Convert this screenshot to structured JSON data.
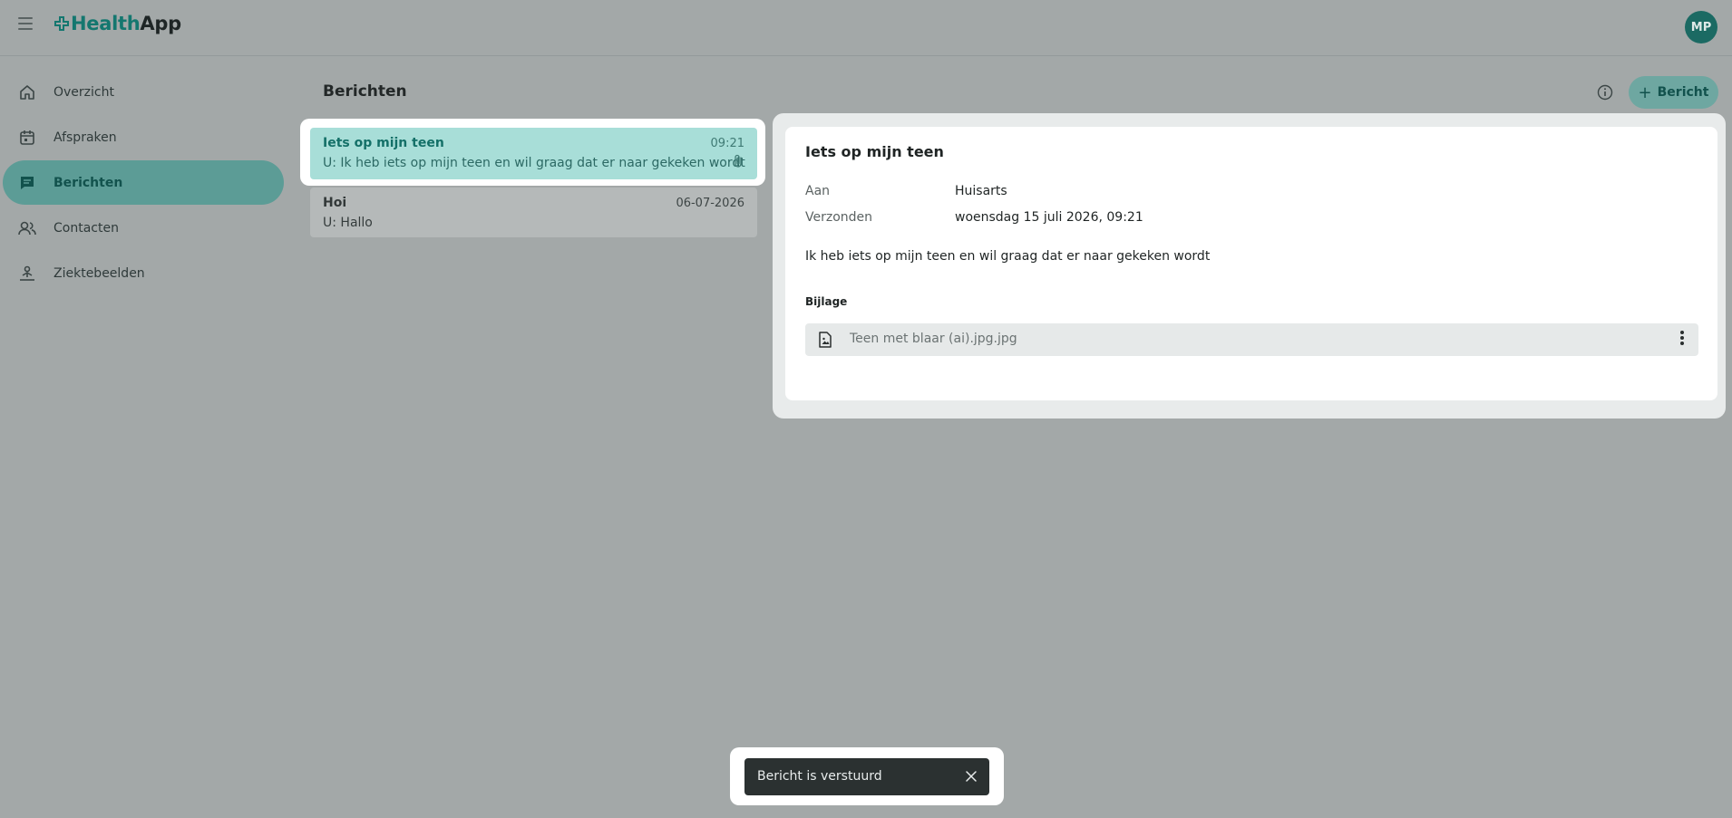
{
  "header": {
    "logo_part1": "Health",
    "logo_part2": "App",
    "avatar_initials": "MP",
    "brand_color": "#14776f"
  },
  "sidebar": {
    "items": [
      {
        "label": "Overzicht",
        "icon": "home-icon"
      },
      {
        "label": "Afspraken",
        "icon": "calendar-icon"
      },
      {
        "label": "Berichten",
        "icon": "message-icon",
        "active": true
      },
      {
        "label": "Contacten",
        "icon": "contacts-icon"
      },
      {
        "label": "Ziektebeelden",
        "icon": "condition-icon"
      }
    ]
  },
  "main": {
    "title": "Berichten",
    "new_button_label": "Bericht",
    "new_button_icon": "plus-icon",
    "info_icon": "info-icon"
  },
  "messages": [
    {
      "subject": "Iets op mijn teen",
      "time": "09:21",
      "preview": "U: Ik heb iets op mijn teen en wil graag dat er naar gekeken wordt",
      "has_attachment": true,
      "selected": true
    },
    {
      "subject": "Hoi",
      "time": "06-07-2026",
      "preview": "U: Hallo",
      "has_attachment": false,
      "selected": false
    }
  ],
  "detail": {
    "subject": "Iets op mijn teen",
    "to_label": "Aan",
    "to_value": "Huisarts",
    "sent_label": "Verzonden",
    "sent_value": "woensdag 15 juli 2026, 09:21",
    "body": "Ik heb iets op mijn teen en wil graag dat er naar gekeken wordt",
    "attachment_heading": "Bijlage",
    "attachment_filename": "Teen met blaar (ai).jpg.jpg",
    "attachment_icon": "image-file-icon"
  },
  "toast": {
    "message": "Bericht is verstuurd",
    "close_icon": "close-icon"
  }
}
